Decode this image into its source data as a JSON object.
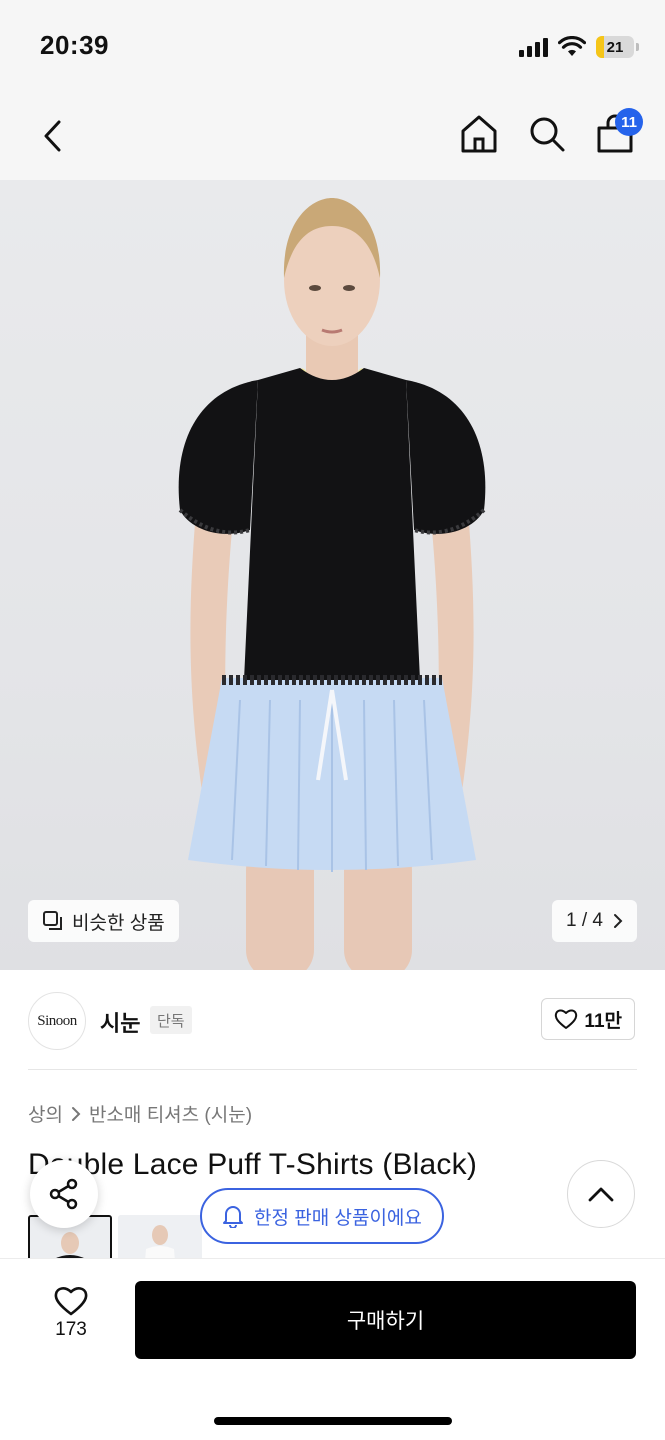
{
  "status_bar": {
    "time": "20:39",
    "battery": "21"
  },
  "nav": {
    "cart_count": "11"
  },
  "hero": {
    "similar_label": "비슷한 상품",
    "page_indicator": "1 / 4"
  },
  "brand": {
    "logo_text": "Sinoon",
    "name": "시눈",
    "tag": "단독",
    "likes": "11만"
  },
  "breadcrumb": {
    "category": "상의",
    "subcategory": "반소매 티셔츠 (시눈)"
  },
  "product": {
    "title": "Double Lace Puff T-Shirts (Black)"
  },
  "limited_label": "한정 판매 상품이에요",
  "bottom": {
    "wish_count": "173",
    "buy_label": "구매하기"
  },
  "colors": {
    "accent": "#3b63e0",
    "badge": "#2563eb",
    "buy": "#000000"
  }
}
